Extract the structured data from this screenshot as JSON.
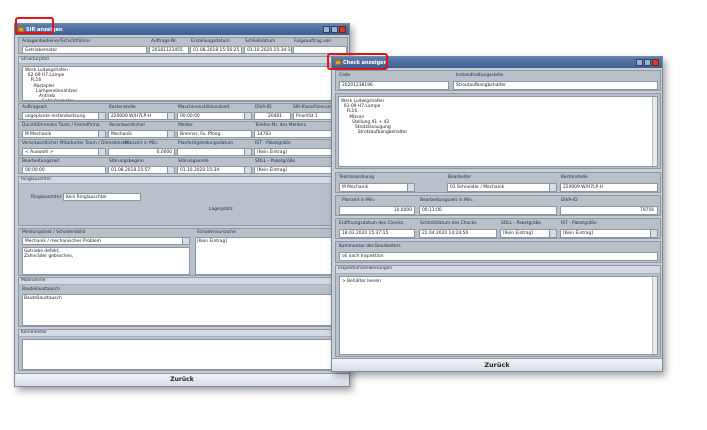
{
  "win1": {
    "title": "SIR anzeigen",
    "cols": [
      "Anlagenbediener/Schichtführer",
      "Auftrags-Nr.",
      "Erstellungsdatum",
      "Schließdatum",
      "Folgeauftrag von"
    ],
    "vals": [
      "Getriebemotor",
      "20181123455",
      "01.08.2018 15:56:25",
      "01.10.2020 15:34:10",
      ""
    ],
    "struktur_label": "Strukturpfad",
    "tree": "Werk Ludwigshafen\n  02-09 H7.Lampe\n    FL16\n      Abstapler\n        Lampendienantzer\n          Antrieb\n            Getriebemotor",
    "r1_labels": [
      "Auftragsart",
      "Kostenstelle",
      "Maschinenstillstandzeit",
      "DIVA-ID",
      "SIR-Klassifizierung"
    ],
    "r1_vals": [
      "ungeplante Instandsetzung",
      "220009 W/H7LP-H",
      "00:00:00",
      "20481",
      "Priorität 1"
    ],
    "r2_labels": [
      "Durchführendes Team / Fremdfirma",
      "Verantwortlicher",
      "Melder",
      "Telefon-Nr. des Melders"
    ],
    "r2_vals": [
      "M Mechanik",
      "Mechanik",
      "Brenner, Fa. Pfoog",
      "14783"
    ],
    "r3_labels": [
      "Verantwortlicher Mitarbeiter Team / Dienstleister",
      "Planzeit in Min.",
      "Planfertigstellungsdatum",
      "IST - Paketgröße"
    ],
    "r3_vals": [
      "< Auswahl >",
      "0,0000",
      "",
      "[Kein Eintrag]"
    ],
    "r4_labels": [
      "Bearbeitungszeit",
      "Störungsbeginn",
      "Störungsende",
      "SOLL - Paketgröße"
    ],
    "r4_vals": [
      "00:00:00",
      "01.08.2018 15:57",
      "01.10.2020 15:34",
      "[Kein Eintrag]"
    ],
    "ring_label": "Ringlauschtel",
    "ring_field_label": "Ringlauschtel:",
    "ring_val": "Kein Ringlauschtel",
    "lager_label": "Lagerplatz:",
    "meldung_label": "Meldungstext / Schadensbild",
    "meldung_dd": "Mechanik / mechanisches Problem",
    "meldung_text": "Getriebe defekt,\nZahnräder gebrochen,",
    "ursache_label": "Schadensursache",
    "ursache_val": "[Kein Eintrag]",
    "massnahme_label": "Maßnahme",
    "bauteil_label": "Bauteilaustausch",
    "bauteil_val": "Bauteilaustausch",
    "kommentar_label": "Kommentar",
    "back": "Zurück"
  },
  "win2": {
    "title": "Check anzeigen",
    "col1": [
      "Code",
      "Instandhaltungsstelle"
    ],
    "val1": [
      "20201238196",
      "Stroutaufbangbehalter"
    ],
    "tree": "Werk Ludwigshafen\n  02-09 H7.Lampe\n    FL16\n      Mikron\n        Stellung 41 + 42\n          Strotzlösaugung\n            Strotzaufbangbehalter",
    "r1_labels": [
      "Teamzuordnung",
      "Bearbeiter",
      "Kostenstelle"
    ],
    "r1_vals": [
      "M Mechanik",
      "01 Schneider / Mechanik",
      "220009 W/H7LP-H"
    ],
    "r2_labels": [
      "Planzeit in Min.",
      "Bearbeitungszeit in Min.",
      "DIVA-ID"
    ],
    "r2_vals": [
      "10,0000",
      "00:11:00",
      "79756"
    ],
    "r3_labels": [
      "Eröffnungsdatum des Checks",
      "Schließdatum des Checks",
      "SOLL - Paketgröße",
      "IST - Paketgröße"
    ],
    "r3_vals": [
      "18.03.2020 15:37:15",
      "22.04.2020 14:24:50",
      "[Kein Eintrag]",
      "[Kein Eintrag]"
    ],
    "komm_label": "Kommentar des Bearbeiters",
    "komm_val": "ok nach Inspektion",
    "insp_label": "Inspektionsanweisungen",
    "insp_val": "> Behälter leeren",
    "back": "Zurück"
  }
}
